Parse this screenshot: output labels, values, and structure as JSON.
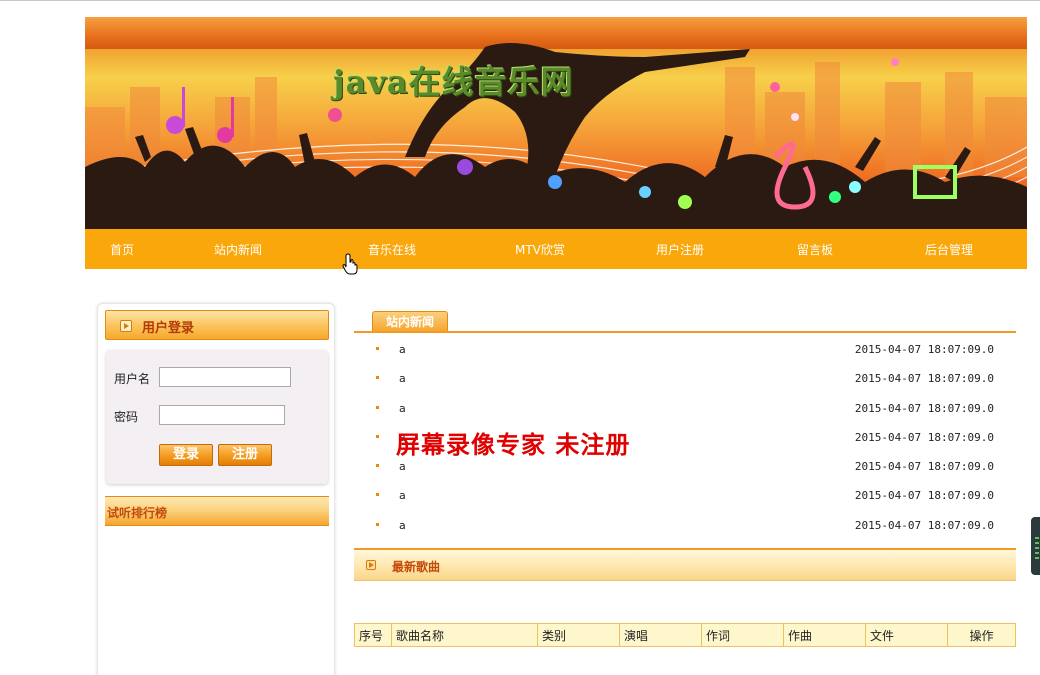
{
  "banner": {
    "title": "java在线音乐网"
  },
  "nav": {
    "items": [
      {
        "label": "首页",
        "id": "home"
      },
      {
        "label": "站内新闻",
        "id": "news"
      },
      {
        "label": "音乐在线",
        "id": "music"
      },
      {
        "label": "MTV欣赏",
        "id": "mtv"
      },
      {
        "label": "用户注册",
        "id": "register"
      },
      {
        "label": "留言板",
        "id": "guestbook"
      },
      {
        "label": "后台管理",
        "id": "admin"
      }
    ]
  },
  "login": {
    "title": "用户登录",
    "username_label": "用户名",
    "username_value": "",
    "password_label": "密码",
    "password_value": "",
    "login_button": "登录",
    "register_button": "注册"
  },
  "ranking": {
    "title": "试听排行榜"
  },
  "news": {
    "tab_label": "站内新闻",
    "items": [
      {
        "title": "a",
        "time": "2015-04-07 18:07:09.0"
      },
      {
        "title": "a",
        "time": "2015-04-07 18:07:09.0"
      },
      {
        "title": "a",
        "time": "2015-04-07 18:07:09.0"
      },
      {
        "title": "a",
        "time": "2015-04-07 18:07:09.0"
      },
      {
        "title": "a",
        "time": "2015-04-07 18:07:09.0"
      },
      {
        "title": "a",
        "time": "2015-04-07 18:07:09.0"
      },
      {
        "title": "a",
        "time": "2015-04-07 18:07:09.0"
      }
    ]
  },
  "watermark": {
    "text": "屏幕录像专家 未注册"
  },
  "songs": {
    "title": "最新歌曲",
    "columns": [
      "序号",
      "歌曲名称",
      "类别",
      "演唱",
      "作词",
      "作曲",
      "文件",
      "操作"
    ]
  },
  "colors": {
    "nav_bg": "#f9a70a",
    "accent_orange": "#f39a24",
    "title_red": "#c44a0a",
    "watermark_red": "#e00000"
  },
  "icons": {
    "cursor": "hand-pointer-icon",
    "panel_bullet": "arrow-right-icon"
  }
}
